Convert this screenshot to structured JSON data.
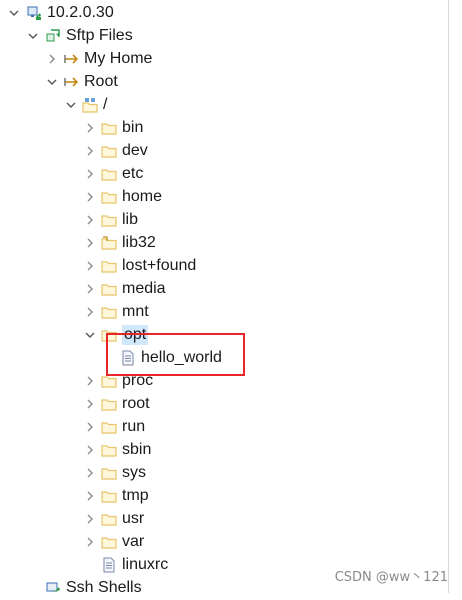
{
  "colors": {
    "folder": "#e8c46a",
    "selection": "#cfe8fb",
    "annotation": "#e8262a"
  },
  "tree": [
    {
      "label": "10.2.0.30",
      "icon": "server-icon",
      "expanded": true
    },
    {
      "label": "Sftp Files",
      "icon": "sftp-icon",
      "expanded": true
    },
    {
      "label": "My Home",
      "icon": "sftp-folder-icon",
      "expanded": false
    },
    {
      "label": "Root",
      "icon": "sftp-folder-icon",
      "expanded": true
    },
    {
      "label": "/",
      "icon": "root-folder-icon",
      "expanded": true
    },
    {
      "label": "bin",
      "icon": "folder-icon",
      "expanded": false
    },
    {
      "label": "dev",
      "icon": "folder-icon",
      "expanded": false
    },
    {
      "label": "etc",
      "icon": "folder-icon",
      "expanded": false
    },
    {
      "label": "home",
      "icon": "folder-icon",
      "expanded": false
    },
    {
      "label": "lib",
      "icon": "folder-icon",
      "expanded": false
    },
    {
      "label": "lib32",
      "icon": "link-folder-icon",
      "expanded": false
    },
    {
      "label": "lost+found",
      "icon": "folder-icon",
      "expanded": false
    },
    {
      "label": "media",
      "icon": "folder-icon",
      "expanded": false
    },
    {
      "label": "mnt",
      "icon": "folder-icon",
      "expanded": false
    },
    {
      "label": "opt",
      "icon": "folder-icon",
      "expanded": true,
      "selected": true
    },
    {
      "label": "hello_world",
      "icon": "file-icon"
    },
    {
      "label": "proc",
      "icon": "folder-icon",
      "expanded": false
    },
    {
      "label": "root",
      "icon": "folder-icon",
      "expanded": false
    },
    {
      "label": "run",
      "icon": "folder-icon",
      "expanded": false
    },
    {
      "label": "sbin",
      "icon": "folder-icon",
      "expanded": false
    },
    {
      "label": "sys",
      "icon": "folder-icon",
      "expanded": false
    },
    {
      "label": "tmp",
      "icon": "folder-icon",
      "expanded": false
    },
    {
      "label": "usr",
      "icon": "folder-icon",
      "expanded": false
    },
    {
      "label": "var",
      "icon": "folder-icon",
      "expanded": false
    },
    {
      "label": "linuxrc",
      "icon": "file-icon"
    },
    {
      "label": "Ssh Shells",
      "icon": "ssh-icon"
    }
  ],
  "watermark": "CSDN @ww丶121"
}
